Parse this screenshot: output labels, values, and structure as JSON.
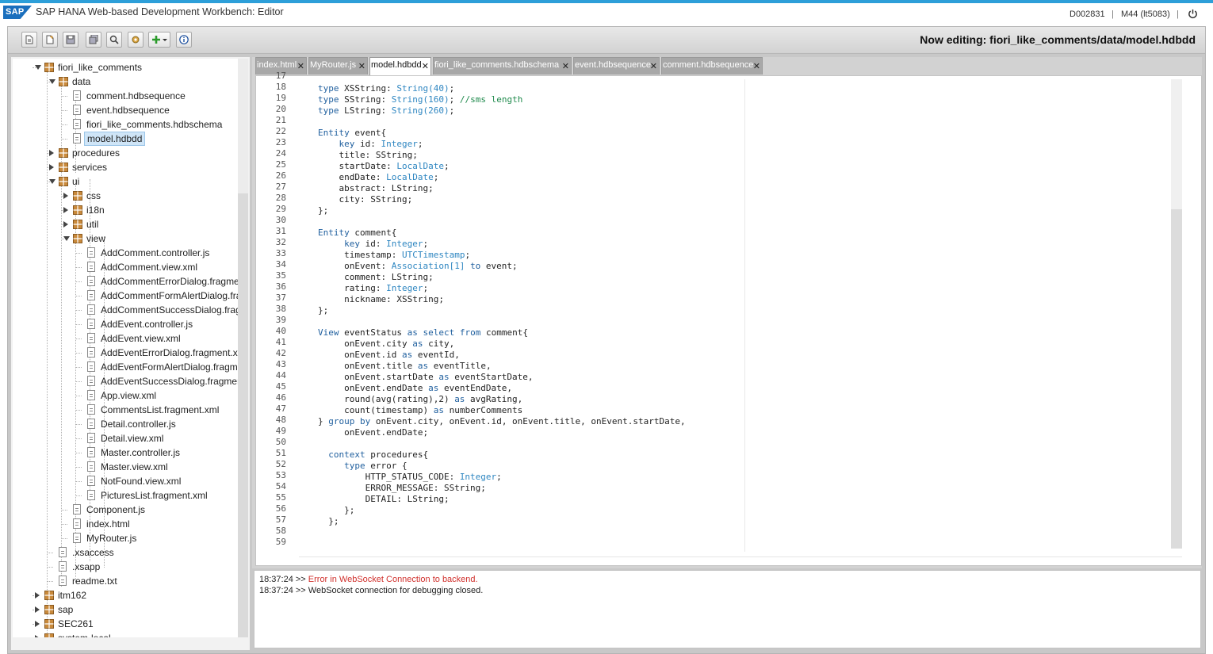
{
  "header": {
    "logo": "SAP",
    "title": "SAP HANA Web-based Development Workbench: Editor",
    "user": "D002831",
    "separator": "|",
    "system": "M44 (lt5083)",
    "power_icon": "power-icon"
  },
  "toolbar": {
    "buttons": [
      "new-file-icon",
      "open-file-icon",
      "save-icon",
      "save-all-icon",
      "search-icon",
      "settings-icon",
      "add-icon",
      "dropdown-icon",
      "info-icon"
    ],
    "now_editing": "Now editing: fiori_like_comments/data/model.hdbdd"
  },
  "tree": {
    "nodes": [
      {
        "label": "fiori_like_comments",
        "type": "folder",
        "state": "open"
      },
      {
        "label": "data",
        "type": "folder",
        "state": "open"
      },
      {
        "label": "comment.hdbsequence",
        "type": "file"
      },
      {
        "label": "event.hdbsequence",
        "type": "file"
      },
      {
        "label": "fiori_like_comments.hdbschema",
        "type": "file"
      },
      {
        "label": "model.hdbdd",
        "type": "file",
        "selected": true
      },
      {
        "label": "procedures",
        "type": "folder",
        "state": "closed"
      },
      {
        "label": "services",
        "type": "folder",
        "state": "closed"
      },
      {
        "label": "ui",
        "type": "folder",
        "state": "open"
      },
      {
        "label": "css",
        "type": "folder",
        "state": "closed"
      },
      {
        "label": "i18n",
        "type": "folder",
        "state": "closed"
      },
      {
        "label": "util",
        "type": "folder",
        "state": "closed"
      },
      {
        "label": "view",
        "type": "folder",
        "state": "open"
      },
      {
        "label": "AddComment.controller.js",
        "type": "file"
      },
      {
        "label": "AddComment.view.xml",
        "type": "file"
      },
      {
        "label": "AddCommentErrorDialog.fragment.xml",
        "type": "file"
      },
      {
        "label": "AddCommentFormAlertDialog.fragment.xml",
        "type": "file"
      },
      {
        "label": "AddCommentSuccessDialog.fragment.xml",
        "type": "file"
      },
      {
        "label": "AddEvent.controller.js",
        "type": "file"
      },
      {
        "label": "AddEvent.view.xml",
        "type": "file"
      },
      {
        "label": "AddEventErrorDialog.fragment.xml",
        "type": "file"
      },
      {
        "label": "AddEventFormAlertDialog.fragment.xml",
        "type": "file"
      },
      {
        "label": "AddEventSuccessDialog.fragment.xml",
        "type": "file"
      },
      {
        "label": "App.view.xml",
        "type": "file"
      },
      {
        "label": "CommentsList.fragment.xml",
        "type": "file"
      },
      {
        "label": "Detail.controller.js",
        "type": "file"
      },
      {
        "label": "Detail.view.xml",
        "type": "file"
      },
      {
        "label": "Master.controller.js",
        "type": "file"
      },
      {
        "label": "Master.view.xml",
        "type": "file"
      },
      {
        "label": "NotFound.view.xml",
        "type": "file"
      },
      {
        "label": "PicturesList.fragment.xml",
        "type": "file"
      },
      {
        "label": "Component.js",
        "type": "file"
      },
      {
        "label": "index.html",
        "type": "file"
      },
      {
        "label": "MyRouter.js",
        "type": "file"
      },
      {
        "label": ".xsaccess",
        "type": "file"
      },
      {
        "label": ".xsapp",
        "type": "file"
      },
      {
        "label": "readme.txt",
        "type": "file"
      },
      {
        "label": "itm162",
        "type": "folder",
        "state": "closed"
      },
      {
        "label": "sap",
        "type": "folder",
        "state": "closed"
      },
      {
        "label": "SEC261",
        "type": "folder",
        "state": "closed"
      },
      {
        "label": "system-local",
        "type": "folder",
        "state": "closed"
      }
    ]
  },
  "tabs": [
    {
      "label": "index.html",
      "active": false
    },
    {
      "label": "MyRouter.js",
      "active": false
    },
    {
      "label": "model.hdbdd",
      "active": true
    },
    {
      "label": "fiori_like_comments.hdbschema",
      "active": false
    },
    {
      "label": "event.hdbsequence",
      "active": false
    },
    {
      "label": "comment.hdbsequence",
      "active": false
    }
  ],
  "tab_close": "✕",
  "editor": {
    "lines": [
      {
        "n": "17",
        "t": ""
      },
      {
        "n": "18",
        "t": "type XSString: String(40);"
      },
      {
        "n": "19",
        "t": "type SString: String(160); //sms length"
      },
      {
        "n": "20",
        "t": "type LString: String(260);"
      },
      {
        "n": "21",
        "t": ""
      },
      {
        "n": "22",
        "t": "Entity event{"
      },
      {
        "n": "23",
        "t": "    key id: Integer;"
      },
      {
        "n": "24",
        "t": "    title: SString;"
      },
      {
        "n": "25",
        "t": "    startDate: LocalDate;"
      },
      {
        "n": "26",
        "t": "    endDate: LocalDate;"
      },
      {
        "n": "27",
        "t": "    abstract: LString;"
      },
      {
        "n": "28",
        "t": "    city: SString;"
      },
      {
        "n": "29",
        "t": "};"
      },
      {
        "n": "30",
        "t": ""
      },
      {
        "n": "31",
        "t": "Entity comment{"
      },
      {
        "n": "32",
        "t": "     key id: Integer;"
      },
      {
        "n": "33",
        "t": "     timestamp: UTCTimestamp;"
      },
      {
        "n": "34",
        "t": "     onEvent: Association[1] to event;"
      },
      {
        "n": "35",
        "t": "     comment: LString;"
      },
      {
        "n": "36",
        "t": "     rating: Integer;"
      },
      {
        "n": "37",
        "t": "     nickname: XSString;"
      },
      {
        "n": "38",
        "t": "};"
      },
      {
        "n": "39",
        "t": ""
      },
      {
        "n": "40",
        "t": "View eventStatus as select from comment{"
      },
      {
        "n": "41",
        "t": "     onEvent.city as city,"
      },
      {
        "n": "42",
        "t": "     onEvent.id as eventId,"
      },
      {
        "n": "43",
        "t": "     onEvent.title as eventTitle,"
      },
      {
        "n": "44",
        "t": "     onEvent.startDate as eventStartDate,"
      },
      {
        "n": "45",
        "t": "     onEvent.endDate as eventEndDate,"
      },
      {
        "n": "46",
        "t": "     round(avg(rating),2) as avgRating,"
      },
      {
        "n": "47",
        "t": "     count(timestamp) as numberComments"
      },
      {
        "n": "48",
        "t": "} group by onEvent.city, onEvent.id, onEvent.title, onEvent.startDate,"
      },
      {
        "n": "49",
        "t": "     onEvent.endDate;"
      },
      {
        "n": "50",
        "t": ""
      },
      {
        "n": "51",
        "t": "  context procedures{"
      },
      {
        "n": "52",
        "t": "     type error {"
      },
      {
        "n": "53",
        "t": "         HTTP_STATUS_CODE: Integer;"
      },
      {
        "n": "54",
        "t": "         ERROR_MESSAGE: SString;"
      },
      {
        "n": "55",
        "t": "         DETAIL: LString;"
      },
      {
        "n": "56",
        "t": "     };"
      },
      {
        "n": "57",
        "t": "  };"
      },
      {
        "n": "58",
        "t": ""
      },
      {
        "n": "59",
        "t": ""
      }
    ]
  },
  "console": {
    "lines": [
      {
        "time": "18:37:24 >> ",
        "msg": "Error in WebSocket Connection to backend.",
        "level": "error"
      },
      {
        "time": "18:37:24 >> ",
        "msg": "WebSocket connection for debugging closed.",
        "level": "info"
      }
    ]
  },
  "colors": {
    "accent_top": "#2d9fd9",
    "sap_blue": "#1b6fbd",
    "selected_bg": "#cfe5f7",
    "tab_inactive": "#a8a8a8",
    "error_text": "#d0312d",
    "folder_icon": "#c98a3c"
  }
}
